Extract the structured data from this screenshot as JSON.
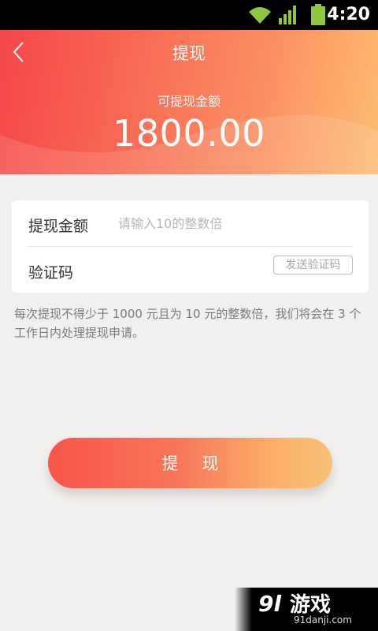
{
  "status_bar": {
    "time": "4:20",
    "icons": [
      "wifi-icon",
      "signal-icon",
      "battery-icon"
    ]
  },
  "header": {
    "title": "提现",
    "balance_label": "可提现金额",
    "balance_amount": "1800.00",
    "colors": {
      "gradient_start": "#f4474a",
      "gradient_end": "#fdbd73"
    }
  },
  "form": {
    "amount_label": "提现金额",
    "amount_value": "",
    "amount_placeholder": "请输入10的整数倍",
    "code_label": "验证码",
    "send_code_label": "发送验证码"
  },
  "notice": "每次提现不得少于 1000 元且为 10 元的整数倍，我们将会在 3 个工作日内处理提现申请。",
  "withdraw_button_label": "提现",
  "watermark": {
    "logo_text": "9l游戏",
    "url": "91danji.com"
  }
}
